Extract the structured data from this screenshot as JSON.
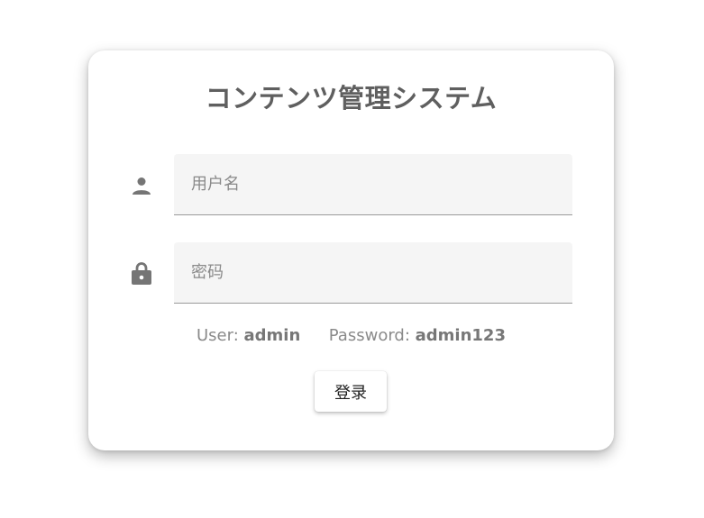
{
  "login": {
    "title": "コンテンツ管理システム",
    "username": {
      "icon": "person-icon",
      "placeholder": "用户名",
      "value": ""
    },
    "password": {
      "icon": "lock-icon",
      "placeholder": "密码",
      "value": ""
    },
    "hint": {
      "user_label": "User:",
      "user_value": "admin",
      "password_label": "Password:",
      "password_value": "admin123"
    },
    "submit_label": "登录"
  },
  "colors": {
    "title": "#5f5f5f",
    "icon": "#757575",
    "field_bg": "#f5f5f5",
    "placeholder": "#8a8a8a"
  }
}
